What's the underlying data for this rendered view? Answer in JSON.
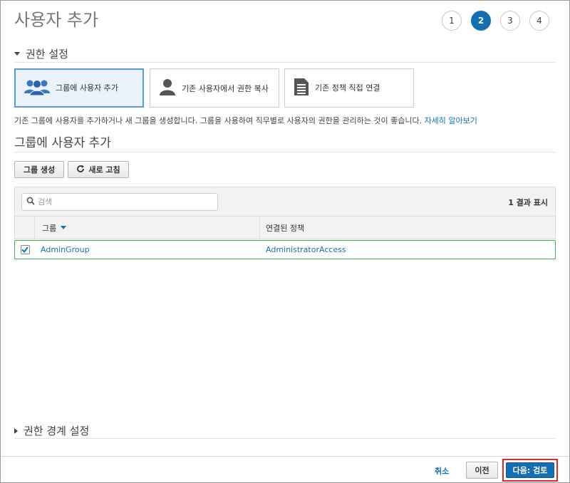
{
  "page": {
    "title": "사용자 추가"
  },
  "steps": [
    {
      "label": "1",
      "active": false
    },
    {
      "label": "2",
      "active": true
    },
    {
      "label": "3",
      "active": false
    },
    {
      "label": "4",
      "active": false
    }
  ],
  "permissions": {
    "heading": "권한 설정",
    "options": [
      {
        "label": "그룹에 사용자 추가",
        "icon": "users-group-icon",
        "selected": true
      },
      {
        "label": "기존 사용자에서 권한 복사",
        "icon": "user-icon",
        "selected": false
      },
      {
        "label": "기존 정책 직접 연결",
        "icon": "document-icon",
        "selected": false
      }
    ],
    "description": "기존 그룹에 사용자를 추가하거나 새 그룹을 생성합니다. 그룹을 사용하여 직무별로 사용자의 권한을 관리하는 것이 좋습니다.",
    "learn_more": "자세히 알아보기"
  },
  "group_section": {
    "heading": "그룹에 사용자 추가",
    "create_group_label": "그룹 생성",
    "refresh_label": "새로 고침",
    "search_placeholder": "검색",
    "result_count": "1 결과 표시",
    "columns": [
      "그룹",
      "연결된 정책"
    ],
    "rows": [
      {
        "checked": true,
        "group": "AdminGroup",
        "policy": "AdministratorAccess"
      }
    ]
  },
  "boundary": {
    "heading": "권한 경계 설정"
  },
  "footer": {
    "cancel_label": "취소",
    "previous_label": "이전",
    "next_label": "다음: 검토"
  },
  "colors": {
    "accent": "#146eb4",
    "selected_row_border": "#3fb34f",
    "highlight_outline": "#e32a2a"
  }
}
